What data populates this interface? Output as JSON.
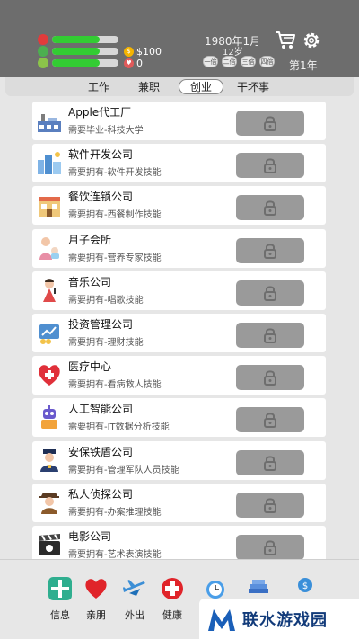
{
  "status": {
    "health": 0.72,
    "mood": 0.72,
    "intellect": 0.72,
    "money": "$100",
    "charm": "0",
    "date": "1980年1月",
    "age": "12岁",
    "speed_buttons": [
      "一倍",
      "二倍",
      "三倍",
      "四倍"
    ],
    "year_label": "第1年"
  },
  "tabs": [
    {
      "label": "工作",
      "active": false
    },
    {
      "label": "兼职",
      "active": false
    },
    {
      "label": "创业",
      "active": true
    },
    {
      "label": "干坏事",
      "active": false
    }
  ],
  "businesses": [
    {
      "name": "Apple代工厂",
      "requirement": "需要毕业-科技大学",
      "icon": "factory-icon",
      "locked": true
    },
    {
      "name": "软件开发公司",
      "requirement": "需要拥有-软件开发技能",
      "icon": "city-icon",
      "locked": true
    },
    {
      "name": "餐饮连锁公司",
      "requirement": "需要拥有-西餐制作技能",
      "icon": "restaurant-icon",
      "locked": true
    },
    {
      "name": "月子会所",
      "requirement": "需要拥有-营养专家技能",
      "icon": "mother-baby-icon",
      "locked": true
    },
    {
      "name": "音乐公司",
      "requirement": "需要拥有-唱歌技能",
      "icon": "singer-icon",
      "locked": true
    },
    {
      "name": "投资管理公司",
      "requirement": "需要拥有-理财技能",
      "icon": "investment-icon",
      "locked": true
    },
    {
      "name": "医疗中心",
      "requirement": "需要拥有-看病救人技能",
      "icon": "medical-heart-icon",
      "locked": true
    },
    {
      "name": "人工智能公司",
      "requirement": "需要拥有-IT数据分析技能",
      "icon": "robot-icon",
      "locked": true
    },
    {
      "name": "安保铁盾公司",
      "requirement": "需要拥有-管理军队人员技能",
      "icon": "security-guard-icon",
      "locked": true
    },
    {
      "name": "私人侦探公司",
      "requirement": "需要拥有-办案推理技能",
      "icon": "detective-icon",
      "locked": true
    },
    {
      "name": "电影公司",
      "requirement": "需要拥有-艺术表演技能",
      "icon": "film-clapper-icon",
      "locked": true
    }
  ],
  "nav": [
    {
      "label": "信息",
      "icon": "info-grid-icon"
    },
    {
      "label": "亲朋",
      "icon": "heart-icon"
    },
    {
      "label": "外出",
      "icon": "airplane-icon"
    },
    {
      "label": "健康",
      "icon": "health-cross-icon"
    },
    {
      "label": "",
      "icon": "alarm-clock-icon"
    },
    {
      "label": "",
      "icon": "books-icon"
    },
    {
      "label": "",
      "icon": "money-icon"
    }
  ],
  "watermark": "联水游戏园",
  "colors": {
    "topbar": "#6d6d6d",
    "bar_green": "#33cc33",
    "lock_button": "#9a9a9a",
    "watermark_text": "#123b7a"
  }
}
